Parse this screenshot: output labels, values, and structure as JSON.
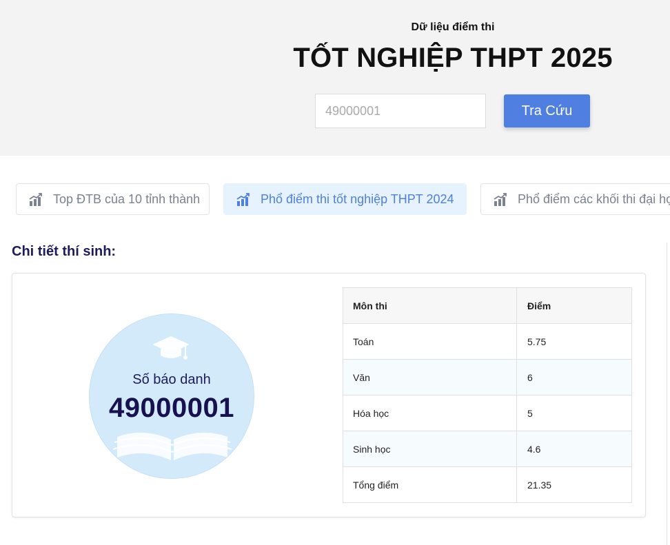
{
  "header": {
    "subtitle": "Dữ liệu điểm thi",
    "title": "TỐT NGHIỆP THPT 2025",
    "search": {
      "value": "",
      "placeholder": "49000001"
    },
    "search_button": "Tra Cứu"
  },
  "tabs": [
    {
      "label": "Top ĐTB của 10 tỉnh thành",
      "icon": "chart-growth-icon",
      "active": false
    },
    {
      "label": "Phổ điểm thi tốt nghiệp THPT 2024",
      "icon": "chart-growth-icon",
      "active": true
    },
    {
      "label": "Phổ điểm các khối thi đại học",
      "icon": "chart-growth-icon",
      "active": false
    }
  ],
  "detail": {
    "heading": "Chi tiết thí sinh:",
    "candidate": {
      "label": "Số báo danh",
      "number": "49000001",
      "icons": [
        "graduation-cap-icon",
        "open-book-icon"
      ]
    },
    "table": {
      "headers": [
        "Môn thi",
        "Điểm"
      ],
      "rows": [
        {
          "subject": "Toán",
          "score": "5.75"
        },
        {
          "subject": "Văn",
          "score": "6"
        },
        {
          "subject": "Hóa học",
          "score": "5"
        },
        {
          "subject": "Sinh học",
          "score": "4.6"
        },
        {
          "subject": "Tổng điểm",
          "score": "21.35"
        }
      ]
    }
  },
  "colors": {
    "accent": "#4f7fe0",
    "active_tab_bg": "#e6f2fd",
    "circle_bg": "#d3eafb",
    "heading": "#1e1b5c"
  }
}
